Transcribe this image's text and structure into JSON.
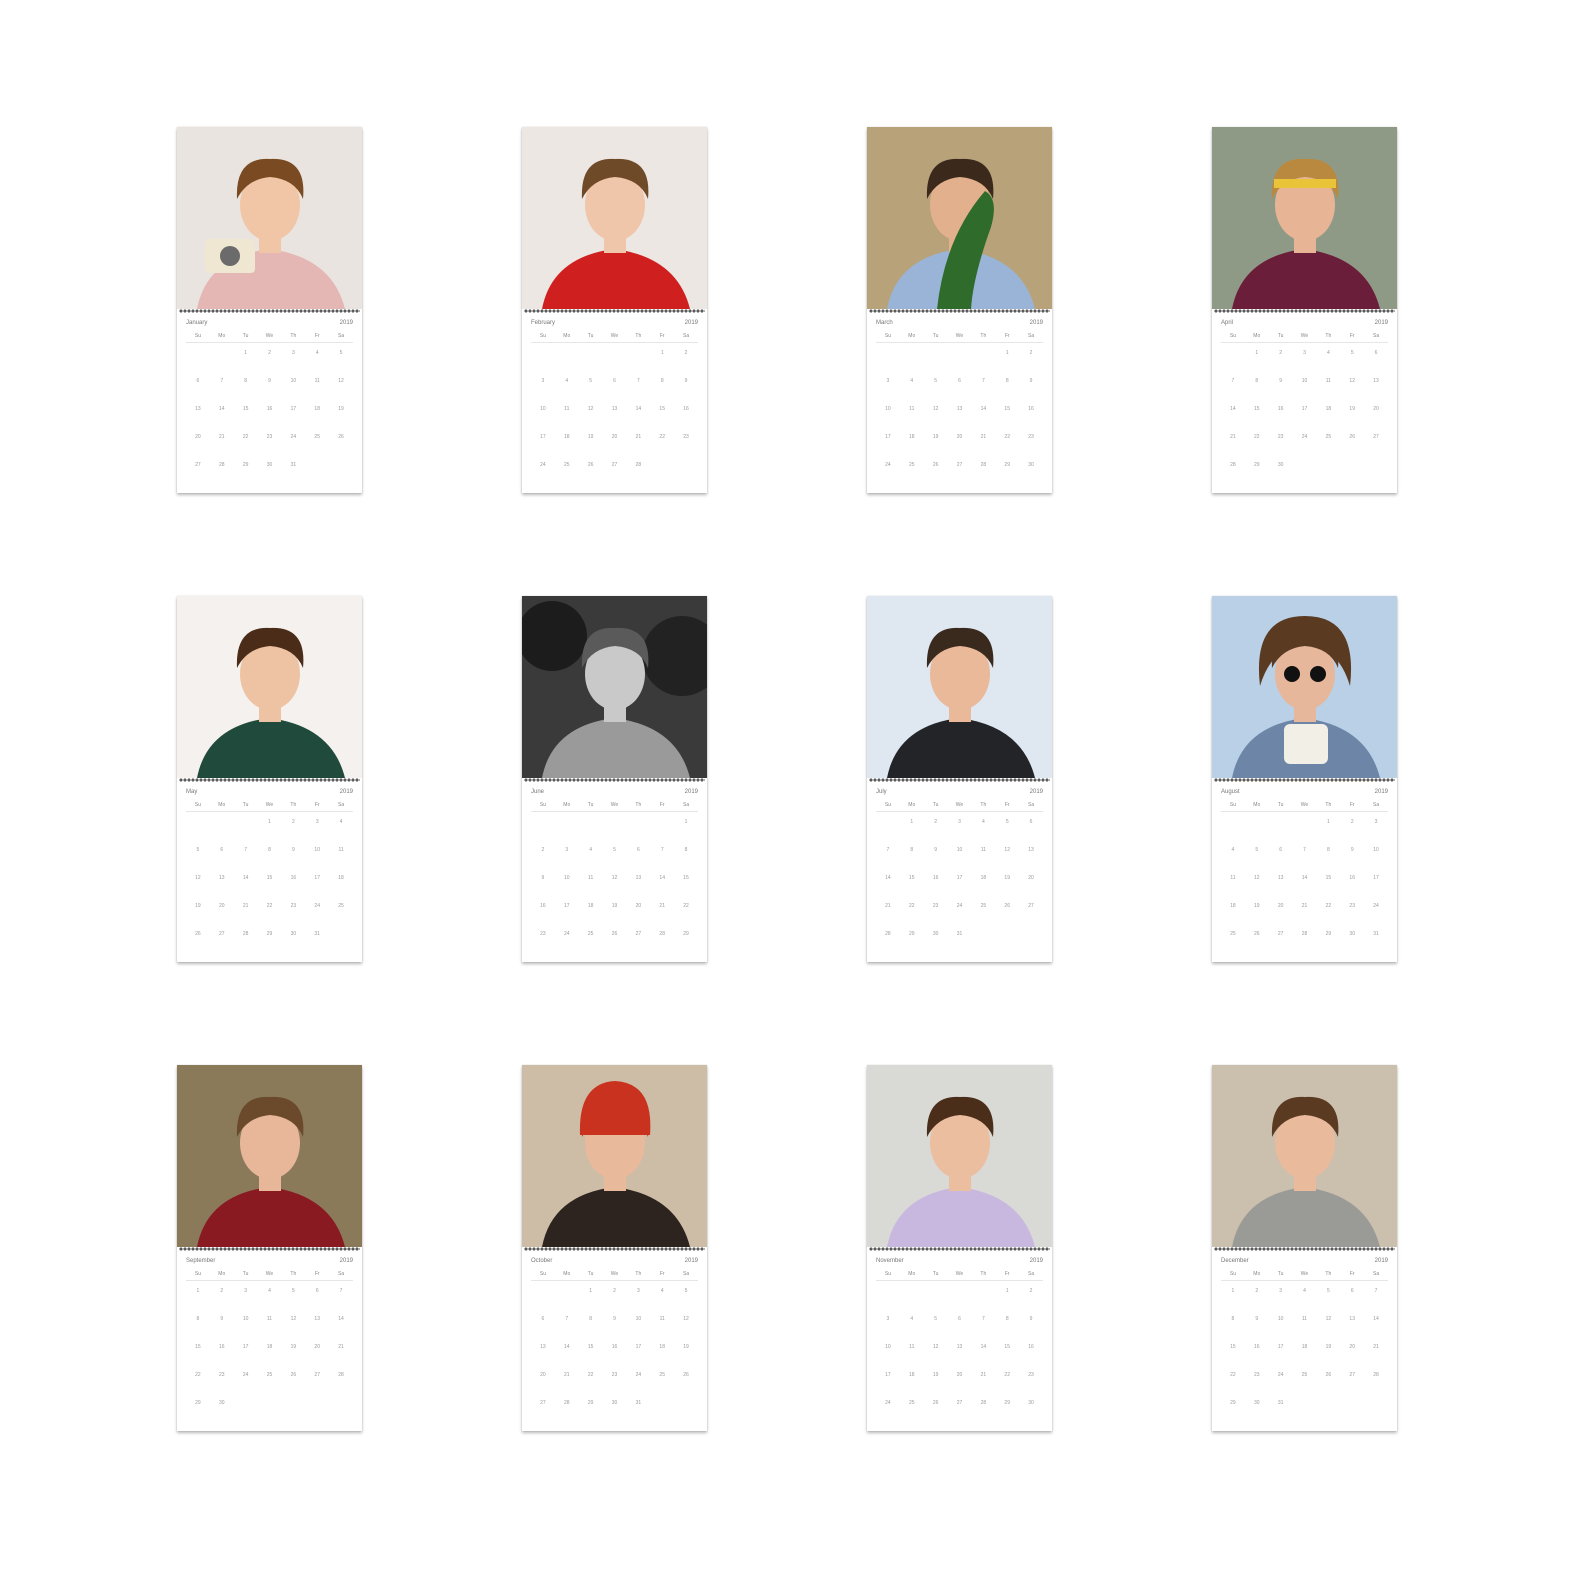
{
  "calendar": {
    "year": "2019",
    "weekdays": [
      "Su",
      "Mo",
      "Tu",
      "We",
      "Th",
      "Fr",
      "Sa"
    ],
    "months": [
      {
        "name": "January",
        "start": 2,
        "days": 31,
        "photo": {
          "bg": "#e9e4df",
          "shirt": "#e4b7b5",
          "hair": "#7a4a22",
          "skin": "#f0c6a6",
          "accent": "#efe7d2",
          "prop": "camera"
        }
      },
      {
        "name": "February",
        "start": 5,
        "days": 28,
        "photo": {
          "bg": "#ece7e3",
          "shirt": "#d01f1f",
          "hair": "#6e4a28",
          "skin": "#efc6a9",
          "accent": "#d01f1f",
          "prop": "none"
        }
      },
      {
        "name": "March",
        "start": 5,
        "days": 31,
        "photo": {
          "bg": "#b8a27a",
          "shirt": "#9ab4d8",
          "hair": "#3b2a1c",
          "skin": "#e2b08c",
          "accent": "#2f6b2a",
          "prop": "cactus"
        }
      },
      {
        "name": "April",
        "start": 1,
        "days": 30,
        "photo": {
          "bg": "#8f9a86",
          "shirt": "#6a1e3a",
          "hair": "#b8893f",
          "skin": "#e7b596",
          "accent": "#e9c338",
          "prop": "headband"
        }
      },
      {
        "name": "May",
        "start": 3,
        "days": 31,
        "photo": {
          "bg": "#f4f1ee",
          "shirt": "#1f4a3c",
          "hair": "#4a2c18",
          "skin": "#eec3a3",
          "accent": "#f0b84a",
          "prop": "none"
        }
      },
      {
        "name": "June",
        "start": 6,
        "days": 30,
        "photo": {
          "bg": "#2a2a2a",
          "shirt": "#9a9a9a",
          "hair": "#5a5a5a",
          "skin": "#c9c9c9",
          "accent": "#1c1c1c",
          "prop": "bw"
        }
      },
      {
        "name": "July",
        "start": 1,
        "days": 31,
        "photo": {
          "bg": "#dfe7f0",
          "shirt": "#222428",
          "hair": "#3a2a1e",
          "skin": "#e9b99a",
          "accent": "#ffffff",
          "prop": "none"
        }
      },
      {
        "name": "August",
        "start": 4,
        "days": 31,
        "photo": {
          "bg": "#b9d0e6",
          "shirt": "#6d86a8",
          "hair": "#5b3a22",
          "skin": "#e6b79a",
          "accent": "#f2efe6",
          "prop": "sunglasses"
        }
      },
      {
        "name": "September",
        "start": 0,
        "days": 30,
        "photo": {
          "bg": "#8a7a5a",
          "shirt": "#8a1a22",
          "hair": "#6a4a2a",
          "skin": "#e8b79a",
          "accent": "#cfc3a6",
          "prop": "none"
        }
      },
      {
        "name": "October",
        "start": 2,
        "days": 31,
        "photo": {
          "bg": "#cdbda6",
          "shirt": "#2d2420",
          "hair": "#c8321e",
          "skin": "#e9b99c",
          "accent": "#9cc0dc",
          "prop": "beanie"
        }
      },
      {
        "name": "November",
        "start": 5,
        "days": 30,
        "photo": {
          "bg": "#d9d9d6",
          "shirt": "#c8b8df",
          "hair": "#4a2e1a",
          "skin": "#ecbea0",
          "accent": "#3a3a3a",
          "prop": "none"
        }
      },
      {
        "name": "December",
        "start": 0,
        "days": 31,
        "photo": {
          "bg": "#cbbfad",
          "shirt": "#9a9a96",
          "hair": "#5a3a20",
          "skin": "#e9bb9c",
          "accent": "#b0472c",
          "prop": "none"
        }
      }
    ]
  }
}
